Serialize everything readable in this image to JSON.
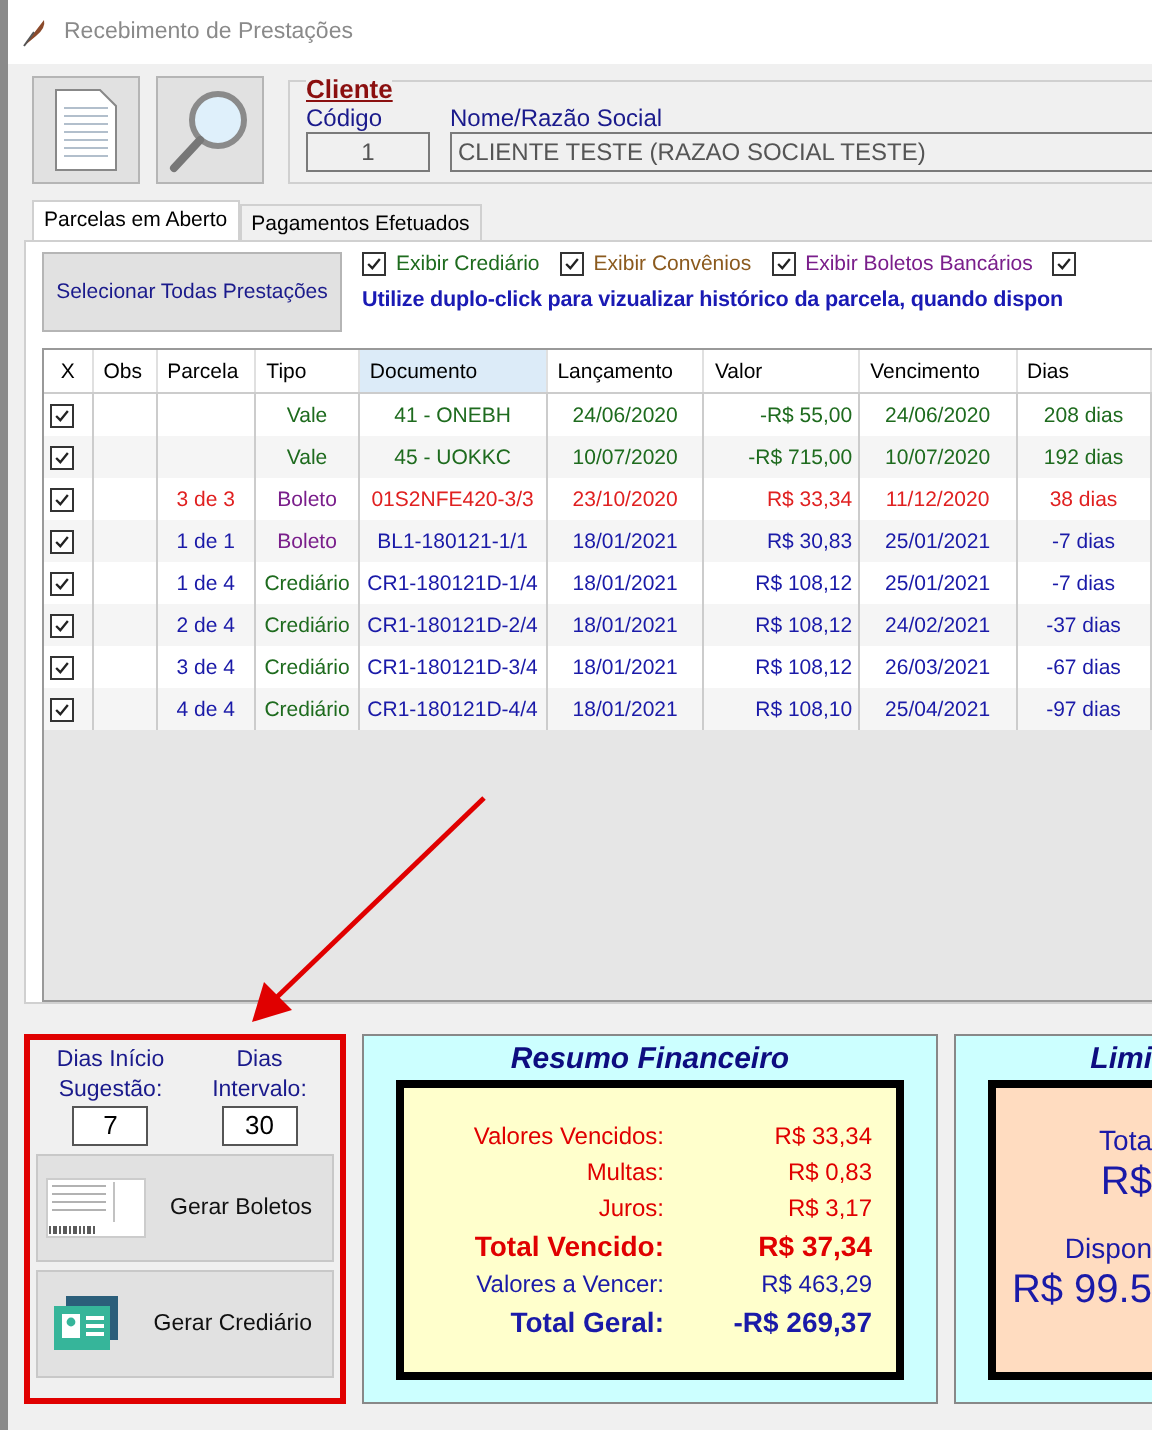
{
  "window": {
    "title": "Recebimento de Prestações"
  },
  "cliente": {
    "title": "Cliente",
    "codigo_label": "Código",
    "codigo": "1",
    "nome_label": "Nome/Razão Social",
    "nome": "CLIENTE TESTE (RAZAO SOCIAL TESTE)"
  },
  "tabs": [
    {
      "label": "Parcelas em Aberto",
      "selected": true
    },
    {
      "label": "Pagamentos Efetuados",
      "selected": false
    }
  ],
  "select_all_button": "Selecionar Todas Prestações",
  "filters": [
    {
      "label": "Exibir Crediário",
      "checked": true,
      "color": "#1e6b1e"
    },
    {
      "label": "Exibir Convênios",
      "checked": true,
      "color": "#8b5a1e"
    },
    {
      "label": "Exibir Boletos Bancários",
      "checked": true,
      "color": "#7a1e8b"
    },
    {
      "checked": true
    }
  ],
  "hint": "Utilize duplo-click para vizualizar histórico da parcela, quando dispon",
  "table": {
    "columns": [
      {
        "label": "X",
        "sorted": false
      },
      {
        "label": "Obs",
        "sorted": false
      },
      {
        "label": "Parcela",
        "sorted": false
      },
      {
        "label": "Tipo",
        "sorted": false
      },
      {
        "label": "Documento",
        "sorted": true
      },
      {
        "label": "Lançamento",
        "sorted": false
      },
      {
        "label": "Valor",
        "sorted": false
      },
      {
        "label": "Vencimento",
        "sorted": false
      },
      {
        "label": "Dias",
        "sorted": false
      }
    ],
    "rows": [
      {
        "checked": true,
        "kind": "vale",
        "overdue": false,
        "parcela": "",
        "tipo": "Vale",
        "documento": "41 - ONEBH",
        "lancamento": "24/06/2020",
        "valor": "-R$ 55,00",
        "vencimento": "24/06/2020",
        "dias": "208 dias"
      },
      {
        "checked": true,
        "kind": "vale",
        "overdue": false,
        "parcela": "",
        "tipo": "Vale",
        "documento": "45 - UOKKC",
        "lancamento": "10/07/2020",
        "valor": "-R$ 715,00",
        "vencimento": "10/07/2020",
        "dias": "192 dias"
      },
      {
        "checked": true,
        "kind": "boleto",
        "overdue": true,
        "parcela": "3 de 3",
        "tipo": "Boleto",
        "documento": "01S2NFE420-3/3",
        "lancamento": "23/10/2020",
        "valor": "R$ 33,34",
        "vencimento": "11/12/2020",
        "dias": "38 dias"
      },
      {
        "checked": true,
        "kind": "boleto",
        "overdue": false,
        "parcela": "1 de 1",
        "tipo": "Boleto",
        "documento": "BL1-180121-1/1",
        "lancamento": "18/01/2021",
        "valor": "R$ 30,83",
        "vencimento": "25/01/2021",
        "dias": "-7 dias"
      },
      {
        "checked": true,
        "kind": "crediario",
        "overdue": false,
        "parcela": "1 de 4",
        "tipo": "Crediário",
        "documento": "CR1-180121D-1/4",
        "lancamento": "18/01/2021",
        "valor": "R$ 108,12",
        "vencimento": "25/01/2021",
        "dias": "-7 dias"
      },
      {
        "checked": true,
        "kind": "crediario",
        "overdue": false,
        "parcela": "2 de 4",
        "tipo": "Crediário",
        "documento": "CR1-180121D-2/4",
        "lancamento": "18/01/2021",
        "valor": "R$ 108,12",
        "vencimento": "24/02/2021",
        "dias": "-37 dias"
      },
      {
        "checked": true,
        "kind": "crediario",
        "overdue": false,
        "parcela": "3 de 4",
        "tipo": "Crediário",
        "documento": "CR1-180121D-3/4",
        "lancamento": "18/01/2021",
        "valor": "R$ 108,12",
        "vencimento": "26/03/2021",
        "dias": "-67 dias"
      },
      {
        "checked": true,
        "kind": "crediario",
        "overdue": false,
        "parcela": "4 de 4",
        "tipo": "Crediário",
        "documento": "CR1-180121D-4/4",
        "lancamento": "18/01/2021",
        "valor": "R$ 108,10",
        "vencimento": "25/04/2021",
        "dias": "-97 dias"
      }
    ]
  },
  "options": {
    "dias_inicio_label": "Dias Início Sugestão:",
    "dias_inicio": "7",
    "dias_intervalo_label": "Dias Intervalo:",
    "dias_intervalo": "30",
    "buttons": [
      {
        "kind": "boleto",
        "label": "Gerar Boletos"
      },
      {
        "kind": "crediario",
        "label": "Gerar Crediário"
      }
    ]
  },
  "resumo": {
    "title": "Resumo Financeiro",
    "lines": [
      {
        "label": "Valores Vencidos:",
        "value": "R$ 33,34",
        "color": "#e00000",
        "bold": false
      },
      {
        "label": "Multas:",
        "value": "R$ 0,83",
        "color": "#e00000",
        "bold": false
      },
      {
        "label": "Juros:",
        "value": "R$ 3,17",
        "color": "#e00000",
        "bold": false
      },
      {
        "label": "Total Vencido:",
        "value": "R$ 37,34",
        "color": "#e00000",
        "bold": true
      },
      {
        "label": "Valores a Vencer:",
        "value": "R$ 463,29",
        "color": "#1a1aa8",
        "bold": false
      },
      {
        "label": "Total Geral:",
        "value": "-R$ 269,37",
        "color": "#1a1aa8",
        "bold": true
      }
    ]
  },
  "limite": {
    "title": "Limi",
    "lines": [
      {
        "text": "Tota",
        "big": false
      },
      {
        "text": "R$",
        "big": true
      },
      {
        "text": "Dispon",
        "big": false
      },
      {
        "text": "R$ 99.5",
        "big": true
      }
    ]
  }
}
